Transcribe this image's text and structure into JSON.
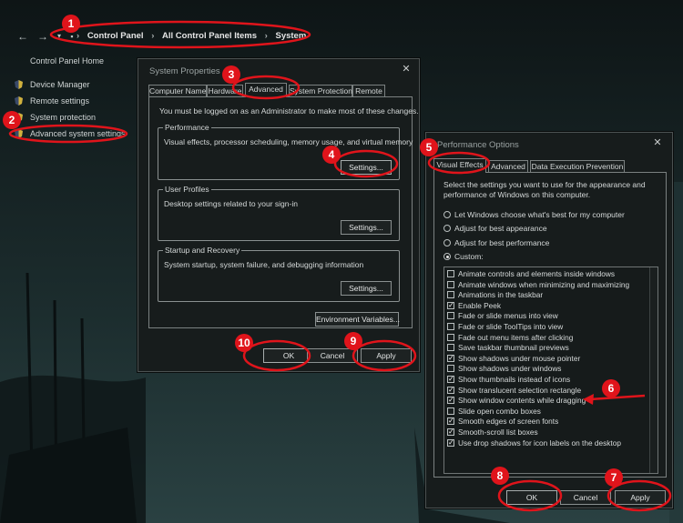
{
  "address_bar": {
    "back_icon": "back-arrow-icon",
    "forward_icon": "forward-arrow-icon",
    "recent_icon": "chevron-down-icon",
    "crumbs": [
      "Control Panel",
      "All Control Panel Items",
      "System"
    ]
  },
  "left_nav": {
    "home": "Control Panel Home",
    "items": [
      "Device Manager",
      "Remote settings",
      "System protection",
      "Advanced system settings"
    ]
  },
  "system_properties": {
    "title": "System Properties",
    "close": "✕",
    "tabs": [
      "Computer Name",
      "Hardware",
      "Advanced",
      "System Protection",
      "Remote"
    ],
    "active_tab": "Advanced",
    "admin_note": "You must be logged on as an Administrator to make most of these changes.",
    "performance": {
      "label": "Performance",
      "text": "Visual effects, processor scheduling, memory usage, and virtual memory",
      "button": "Settings..."
    },
    "user_profiles": {
      "label": "User Profiles",
      "text": "Desktop settings related to your sign-in",
      "button": "Settings..."
    },
    "startup_recovery": {
      "label": "Startup and Recovery",
      "text": "System startup, system failure, and debugging information",
      "button": "Settings..."
    },
    "env_button": "Environment Variables...",
    "ok": "OK",
    "cancel": "Cancel",
    "apply": "Apply"
  },
  "performance_options": {
    "title": "Performance Options",
    "close": "✕",
    "tabs": [
      "Visual Effects",
      "Advanced",
      "Data Execution Prevention"
    ],
    "active_tab": "Visual Effects",
    "intro_line1": "Select the settings you want to use for the appearance and",
    "intro_line2": "performance of Windows on this computer.",
    "radios": [
      {
        "label": "Let Windows choose what's best for my computer",
        "checked": false
      },
      {
        "label": "Adjust for best appearance",
        "checked": false
      },
      {
        "label": "Adjust for best performance",
        "checked": false
      },
      {
        "label": "Custom:",
        "checked": true
      }
    ],
    "effects": [
      {
        "label": "Animate controls and elements inside windows",
        "checked": false
      },
      {
        "label": "Animate windows when minimizing and maximizing",
        "checked": false
      },
      {
        "label": "Animations in the taskbar",
        "checked": false
      },
      {
        "label": "Enable Peek",
        "checked": true
      },
      {
        "label": "Fade or slide menus into view",
        "checked": false
      },
      {
        "label": "Fade or slide ToolTips into view",
        "checked": false
      },
      {
        "label": "Fade out menu items after clicking",
        "checked": false
      },
      {
        "label": "Save taskbar thumbnail previews",
        "checked": false
      },
      {
        "label": "Show shadows under mouse pointer",
        "checked": true
      },
      {
        "label": "Show shadows under windows",
        "checked": false
      },
      {
        "label": "Show thumbnails instead of icons",
        "checked": true
      },
      {
        "label": "Show translucent selection rectangle",
        "checked": true
      },
      {
        "label": "Show window contents while dragging",
        "checked": true
      },
      {
        "label": "Slide open combo boxes",
        "checked": false
      },
      {
        "label": "Smooth edges of screen fonts",
        "checked": true
      },
      {
        "label": "Smooth-scroll list boxes",
        "checked": true
      },
      {
        "label": "Use drop shadows for icon labels on the desktop",
        "checked": true
      }
    ],
    "ok": "OK",
    "cancel": "Cancel",
    "apply": "Apply"
  },
  "annotations": {
    "color": "#e0141b",
    "step_numbers": [
      "1",
      "2",
      "3",
      "4",
      "5",
      "6",
      "7",
      "8",
      "9",
      "10"
    ]
  }
}
